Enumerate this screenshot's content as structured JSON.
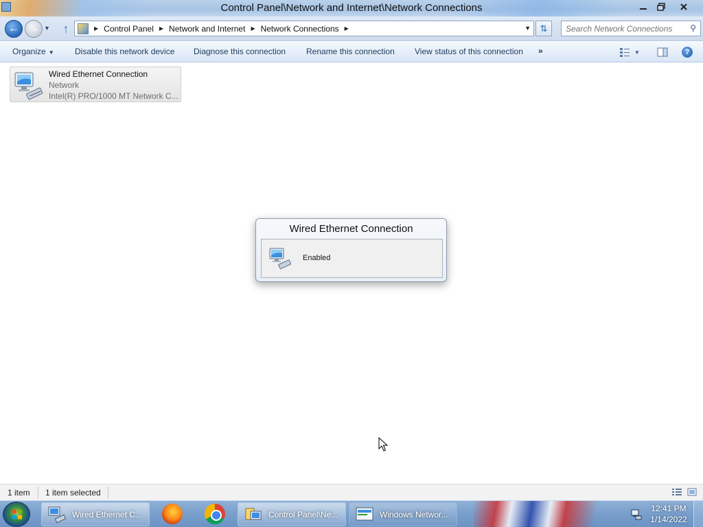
{
  "window": {
    "title": "Control Panel\\Network and Internet\\Network Connections",
    "minimize_icon": "minimize-icon",
    "maximize_icon": "restore-icon",
    "close_icon": "close-icon"
  },
  "address_bar": {
    "breadcrumbs": [
      "Control Panel",
      "Network and Internet",
      "Network Connections"
    ],
    "search_placeholder": "Search Network Connections"
  },
  "toolbar": {
    "organize_label": "Organize",
    "disable_label": "Disable this network device",
    "diagnose_label": "Diagnose this connection",
    "rename_label": "Rename this connection",
    "view_status_label": "View status of this connection",
    "more_label": "»"
  },
  "connections": [
    {
      "name": "Wired Ethernet Connection",
      "network": "Network",
      "adapter": "Intel(R) PRO/1000 MT Network C..."
    }
  ],
  "popup": {
    "title": "Wired Ethernet Connection",
    "status": "Enabled"
  },
  "status_bar": {
    "item_count": "1 item",
    "selected_count": "1 item selected"
  },
  "taskbar": {
    "buttons": [
      {
        "label": "Wired Ethernet C..."
      },
      {
        "label": "Control Panel\\Ne..."
      },
      {
        "label": "Windows Networ..."
      }
    ],
    "clock_time": "12:41 PM",
    "clock_date": "1/14/2022"
  },
  "colors": {
    "accent": "#1e395b",
    "titlebar": "#a6c3e4",
    "taskbar": "#7aa0cc"
  }
}
